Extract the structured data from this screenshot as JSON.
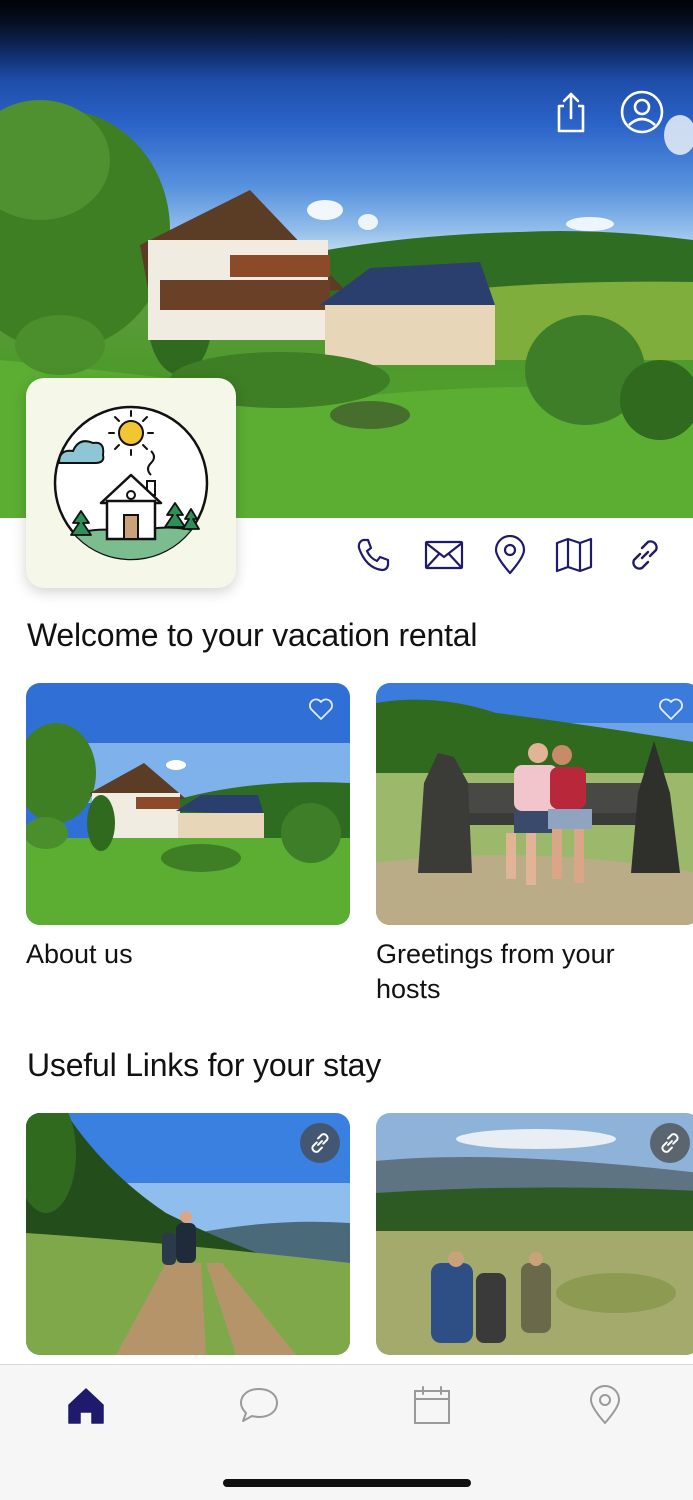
{
  "app": {
    "accent_color": "#1f1a6b",
    "inactive_color": "#9a9a9a"
  },
  "hero": {
    "share_icon": "share-icon",
    "profile_icon": "profile-icon"
  },
  "contact_icons": [
    "phone-icon",
    "mail-icon",
    "location-pin-icon",
    "map-icon",
    "link-icon"
  ],
  "welcome_section": {
    "title": "Welcome to your vacation rental",
    "cards": [
      {
        "title": "About us",
        "icon": "heart-icon"
      },
      {
        "title": "Greetings from your hosts",
        "icon": "heart-icon"
      }
    ]
  },
  "links_section": {
    "title": "Useful Links for your stay",
    "cards": [
      {
        "icon": "link-icon"
      },
      {
        "icon": "link-icon"
      }
    ]
  },
  "tabbar": {
    "tabs": [
      {
        "icon": "home-icon",
        "active": true
      },
      {
        "icon": "chat-icon",
        "active": false
      },
      {
        "icon": "calendar-icon",
        "active": false
      },
      {
        "icon": "location-pin-icon",
        "active": false
      }
    ]
  }
}
